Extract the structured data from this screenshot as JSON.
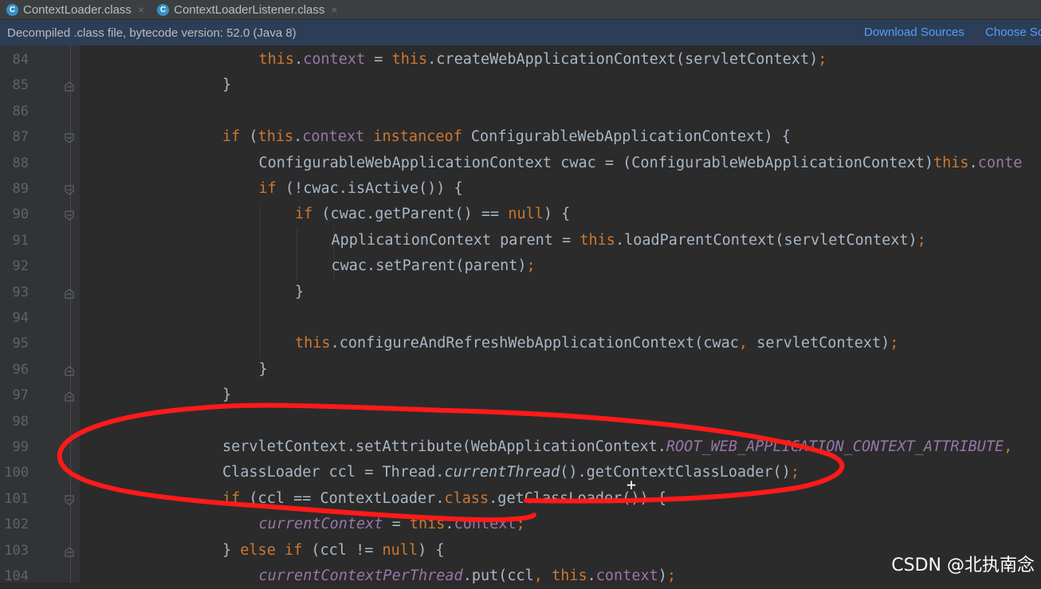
{
  "tabs": [
    {
      "label": "ContextLoader.class",
      "icon": "class-icon",
      "close": "×"
    },
    {
      "label": "ContextLoaderListener.class",
      "icon": "class-icon",
      "close": "×"
    }
  ],
  "banner": {
    "message": "Decompiled .class file, bytecode version: 52.0 (Java 8)",
    "download_sources": "Download Sources",
    "choose_sources": "Choose Sc"
  },
  "lines": [
    {
      "n": "84",
      "fold": "none"
    },
    {
      "n": "85",
      "fold": "end"
    },
    {
      "n": "86",
      "fold": "none"
    },
    {
      "n": "87",
      "fold": "start"
    },
    {
      "n": "88",
      "fold": "none"
    },
    {
      "n": "89",
      "fold": "start"
    },
    {
      "n": "90",
      "fold": "start"
    },
    {
      "n": "91",
      "fold": "none"
    },
    {
      "n": "92",
      "fold": "none"
    },
    {
      "n": "93",
      "fold": "end"
    },
    {
      "n": "94",
      "fold": "none"
    },
    {
      "n": "95",
      "fold": "none"
    },
    {
      "n": "96",
      "fold": "end"
    },
    {
      "n": "97",
      "fold": "end"
    },
    {
      "n": "98",
      "fold": "none"
    },
    {
      "n": "99",
      "fold": "none"
    },
    {
      "n": "100",
      "fold": "none"
    },
    {
      "n": "101",
      "fold": "start"
    },
    {
      "n": "102",
      "fold": "none"
    },
    {
      "n": "103",
      "fold": "end"
    },
    {
      "n": "104",
      "fold": "none"
    }
  ],
  "code": {
    "l84": [
      "this",
      ".",
      "context",
      " = ",
      "this",
      ".createWebApplicationContext(servletContext)",
      ";"
    ],
    "l85": [
      "}"
    ],
    "l87": [
      "if",
      " (",
      "this",
      ".",
      "context",
      " ",
      "instanceof",
      " ConfigurableWebApplicationContext) {"
    ],
    "l88": [
      "ConfigurableWebApplicationContext cwac = (ConfigurableWebApplicationContext)",
      "this",
      ".",
      "conte"
    ],
    "l89": [
      "if",
      " (!cwac.isActive()) {"
    ],
    "l90": [
      "if",
      " (cwac.getParent() == ",
      "null",
      ") {"
    ],
    "l91": [
      "ApplicationContext parent = ",
      "this",
      ".loadParentContext(servletContext)",
      ";"
    ],
    "l92": [
      "cwac.setParent(parent)",
      ";"
    ],
    "l93": [
      "}"
    ],
    "l95": [
      "this",
      ".configureAndRefreshWebApplicationContext(cwac",
      ",",
      " servletContext)",
      ";"
    ],
    "l96": [
      "}"
    ],
    "l97": [
      "}"
    ],
    "l99": [
      "servletContext.setAttribute(WebApplicationContext.",
      "ROOT_WEB_APPLICATION_CONTEXT_ATTRIBUTE",
      ","
    ],
    "l100": [
      "ClassLoader ccl = Thread.",
      "currentThread",
      "().getContextClassLoader()",
      ";"
    ],
    "l101": [
      "if",
      " (ccl == ContextLoader.",
      "class",
      ".getClassLoader()) {"
    ],
    "l102": [
      "currentContext",
      " = ",
      "this",
      ".",
      "context",
      ";"
    ],
    "l103": [
      "} ",
      "else",
      " ",
      "if",
      " (ccl != ",
      "null",
      ") {"
    ],
    "l104": [
      "currentContextPerThread",
      ".put(ccl",
      ",",
      " ",
      "this",
      ".",
      "context",
      ")",
      ";"
    ]
  },
  "watermark": "CSDN @北执南念",
  "colors": {
    "background": "#2b2b2b",
    "keyword": "#cc7832",
    "field": "#9876aa",
    "text": "#a9b7c6",
    "annotation": "#ff1a1a",
    "banner": "#2c3e57"
  }
}
